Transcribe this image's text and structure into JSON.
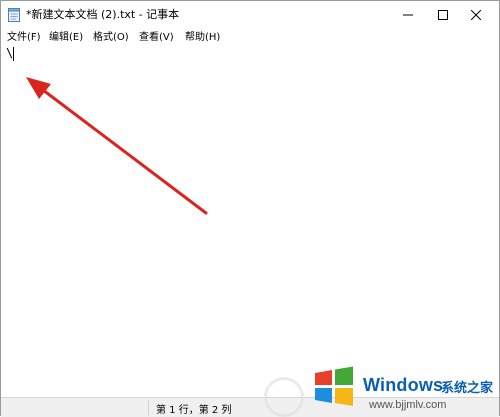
{
  "window": {
    "title": "*新建文本文档 (2).txt - 记事本",
    "icons": {
      "app": "notepad-icon",
      "minimize": "minimize-icon",
      "maximize": "maximize-icon",
      "close": "close-icon"
    }
  },
  "menubar": {
    "items": [
      "文件(F)",
      "编辑(E)",
      "格式(O)",
      "查看(V)",
      "帮助(H)"
    ]
  },
  "editor": {
    "content": "\\"
  },
  "annotation": {
    "arrow_color": "#d9251d"
  },
  "statusbar": {
    "position_text": "第 1 行，第 2 列"
  },
  "watermark": {
    "brand": "Windows",
    "brand_cn": "系统之家",
    "url": "www.bjjmlv.com"
  }
}
